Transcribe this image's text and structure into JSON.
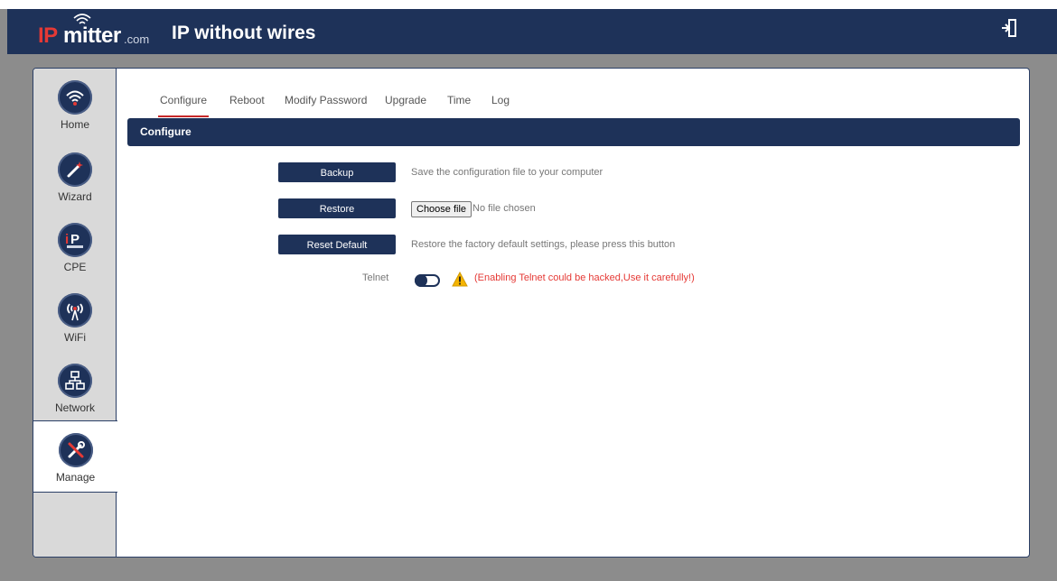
{
  "header": {
    "logo_ip": "IP",
    "logo_mitter": "mitter",
    "logo_com": ".com",
    "tagline": "IP without wires"
  },
  "sidebar": {
    "items": [
      {
        "label": "Home",
        "icon": "wifi-icon"
      },
      {
        "label": "Wizard",
        "icon": "wand-icon"
      },
      {
        "label": "CPE",
        "icon": "cpe-icon"
      },
      {
        "label": "WiFi",
        "icon": "antenna-icon"
      },
      {
        "label": "Network",
        "icon": "network-icon"
      },
      {
        "label": "Manage",
        "icon": "tools-icon",
        "active": true
      }
    ]
  },
  "tabs": [
    "Configure",
    "Reboot",
    "Modify Password",
    "Upgrade",
    "Time",
    "Log"
  ],
  "active_tab": "Configure",
  "section_title": "Configure",
  "actions": {
    "backup_label": "Backup",
    "backup_desc": "Save the configuration file to your computer",
    "restore_label": "Restore",
    "choose_file_label": "Choose file",
    "no_file_text": "No file chosen",
    "reset_label": "Reset Default",
    "reset_desc": "Restore the factory default settings, please press this button",
    "telnet_label": "Telnet",
    "telnet_enabled": false,
    "telnet_warning": "(Enabling Telnet could be hacked,Use it carefully!)"
  },
  "colors": {
    "navy": "#1e3259",
    "accent_red": "#e53935",
    "background": "#8c8c8c"
  }
}
